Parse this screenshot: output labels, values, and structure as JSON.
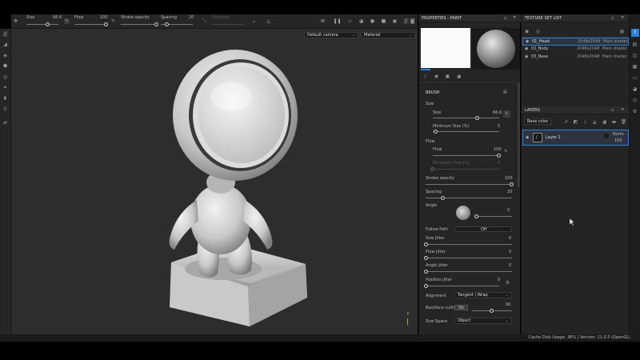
{
  "toolbar": {
    "size_label": "Size",
    "size_value": "66.6",
    "flow_label": "Flow",
    "flow_value": "100",
    "stroke_opacity_label": "Stroke opacity",
    "spacing_label": "Spacing",
    "spacing_value": "20",
    "distance_label": "Distance",
    "size_fraction": 0.67,
    "flow_fraction": 1.0,
    "stroke_opacity_fraction": 1.0,
    "spacing_fraction": 0.2
  },
  "viewport": {
    "camera_select": "Default camera",
    "display_select": "Material",
    "axis_label": "Y"
  },
  "properties": {
    "title": "PROPERTIES - PAINT",
    "brush_heading": "BRUSH",
    "size_group": "Size",
    "size_label": "Size",
    "size_value": "66.6",
    "size_fraction": 0.67,
    "min_size_label": "Minimum Size (%)",
    "min_size_value": "5",
    "min_size_fraction": 0.05,
    "flow_group": "Flow",
    "flow_label": "Flow",
    "flow_value": "100",
    "flow_fraction": 1.0,
    "min_flow_label": "Minimum Flow (%)",
    "min_flow_value": "0",
    "min_flow_fraction": 0.0,
    "stroke_opacity_label": "Stroke opacity",
    "stroke_opacity_value": "100",
    "stroke_opacity_fraction": 1.0,
    "spacing_label": "Spacing",
    "spacing_value": "20",
    "spacing_fraction": 0.2,
    "angle_label": "Angle",
    "angle_value": "0",
    "angle_fraction": 0.0,
    "follow_path_label": "Follow Path",
    "follow_path_value": "Off",
    "size_jitter_label": "Size jitter",
    "size_jitter_value": "0",
    "flow_jitter_label": "Flow jitter",
    "flow_jitter_value": "0",
    "angle_jitter_label": "Angle jitter",
    "angle_jitter_value": "0",
    "position_jitter_label": "Position jitter",
    "position_jitter_value": "0",
    "alignment_label": "Alignment",
    "alignment_value": "Tangent | Wrap",
    "backface_label": "Backface culling",
    "backface_toggle": "On",
    "backface_value": "90",
    "backface_fraction": 0.5,
    "size_space_label": "Size Space",
    "size_space_value": "Object"
  },
  "texture_set_list": {
    "title": "TEXTURE SET LIST",
    "items": [
      {
        "name": "01_Head",
        "resolution": "2048x2048",
        "shader": "Main shader"
      },
      {
        "name": "02_Body",
        "resolution": "2048x2048",
        "shader": "Main shader"
      },
      {
        "name": "03_Base",
        "resolution": "2048x2048",
        "shader": "Main shader"
      }
    ]
  },
  "layers": {
    "title": "LAYERS",
    "channel_select": "Base color",
    "layer_name": "Layer 1",
    "blend_mode": "Norm",
    "opacity": "100"
  },
  "status": {
    "text": "Cache Disk Usage:   36% | Version: 11.0.3 (OpenGL)"
  },
  "colors": {
    "accent": "#2f7fd8",
    "panel": "#252525",
    "viewport": "#2d2d2d"
  }
}
